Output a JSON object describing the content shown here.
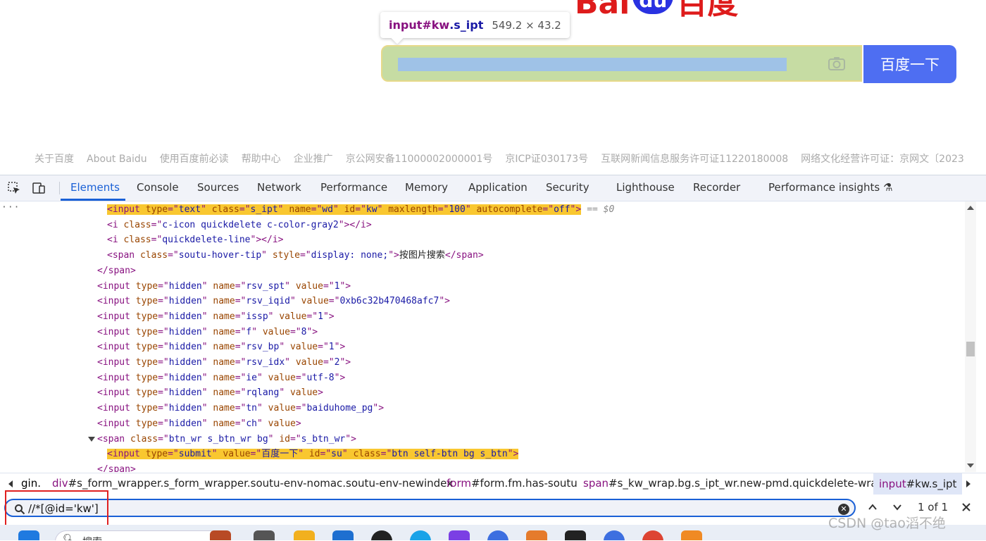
{
  "page": {
    "logo_text_left": "Bai",
    "logo_text_paw": "du",
    "logo_text_right": "百度",
    "tooltip": {
      "tag": "input",
      "id": "#kw",
      "class": ".s_ipt",
      "size": "549.2 × 43.2"
    },
    "search_button": "百度一下",
    "footer": [
      "关于百度",
      "About Baidu",
      "使用百度前必读",
      "帮助中心",
      "企业推广",
      "京公网安备11000002000001号",
      "京ICP证030173号",
      "互联网新闻信息服务许可证11220180008",
      "网络文化经营许可证：京网文〔2023"
    ]
  },
  "devtools": {
    "tabs": [
      "Elements",
      "Console",
      "Sources",
      "Network",
      "Performance",
      "Memory",
      "Application",
      "Security",
      "Lighthouse",
      "Recorder",
      "Performance insights"
    ],
    "active_tab": "Elements",
    "selected_suffix": "== $0",
    "lines": [
      [
        [
          "t",
          "<input "
        ],
        [
          "a",
          "type"
        ],
        [
          "t",
          "=\""
        ],
        [
          "v",
          "text"
        ],
        [
          "t",
          "\" "
        ],
        [
          "a",
          "class"
        ],
        [
          "t",
          "=\""
        ],
        [
          "v",
          "s_ipt"
        ],
        [
          "t",
          "\" "
        ],
        [
          "a",
          "name"
        ],
        [
          "t",
          "=\""
        ],
        [
          "v",
          "wd"
        ],
        [
          "t",
          "\" "
        ],
        [
          "a",
          "id"
        ],
        [
          "t",
          "=\""
        ],
        [
          "v",
          "kw"
        ],
        [
          "t",
          "\" "
        ],
        [
          "a",
          "maxlength"
        ],
        [
          "t",
          "=\""
        ],
        [
          "v",
          "100"
        ],
        [
          "t",
          "\" "
        ],
        [
          "a",
          "autocomplete"
        ],
        [
          "t",
          "=\""
        ],
        [
          "v",
          "off"
        ],
        [
          "t",
          "\">"
        ]
      ],
      [
        [
          "t",
          "<i "
        ],
        [
          "a",
          "class"
        ],
        [
          "t",
          "=\""
        ],
        [
          "v",
          "c-icon quickdelete c-color-gray2"
        ],
        [
          "t",
          "\">"
        ],
        [
          "x",
          ""
        ],
        [
          "t",
          "</i>"
        ]
      ],
      [
        [
          "t",
          "<i "
        ],
        [
          "a",
          "class"
        ],
        [
          "t",
          "=\""
        ],
        [
          "v",
          "quickdelete-line"
        ],
        [
          "t",
          "\"></i>"
        ]
      ],
      [
        [
          "t",
          "<span "
        ],
        [
          "a",
          "class"
        ],
        [
          "t",
          "=\""
        ],
        [
          "v",
          "soutu-hover-tip"
        ],
        [
          "t",
          "\" "
        ],
        [
          "a",
          "style"
        ],
        [
          "t",
          "=\""
        ],
        [
          "v",
          "display: none;"
        ],
        [
          "t",
          "\">"
        ],
        [
          "x",
          "按图片搜索"
        ],
        [
          "t",
          "</span>"
        ]
      ],
      [
        [
          "t",
          "</span>"
        ]
      ],
      [
        [
          "t",
          "<input "
        ],
        [
          "a",
          "type"
        ],
        [
          "t",
          "=\""
        ],
        [
          "v",
          "hidden"
        ],
        [
          "t",
          "\" "
        ],
        [
          "a",
          "name"
        ],
        [
          "t",
          "=\""
        ],
        [
          "v",
          "rsv_spt"
        ],
        [
          "t",
          "\" "
        ],
        [
          "a",
          "value"
        ],
        [
          "t",
          "=\""
        ],
        [
          "v",
          "1"
        ],
        [
          "t",
          "\">"
        ]
      ],
      [
        [
          "t",
          "<input "
        ],
        [
          "a",
          "type"
        ],
        [
          "t",
          "=\""
        ],
        [
          "v",
          "hidden"
        ],
        [
          "t",
          "\" "
        ],
        [
          "a",
          "name"
        ],
        [
          "t",
          "=\""
        ],
        [
          "v",
          "rsv_iqid"
        ],
        [
          "t",
          "\" "
        ],
        [
          "a",
          "value"
        ],
        [
          "t",
          "=\""
        ],
        [
          "v",
          "0xb6c32b470468afc7"
        ],
        [
          "t",
          "\">"
        ]
      ],
      [
        [
          "t",
          "<input "
        ],
        [
          "a",
          "type"
        ],
        [
          "t",
          "=\""
        ],
        [
          "v",
          "hidden"
        ],
        [
          "t",
          "\" "
        ],
        [
          "a",
          "name"
        ],
        [
          "t",
          "=\""
        ],
        [
          "v",
          "issp"
        ],
        [
          "t",
          "\" "
        ],
        [
          "a",
          "value"
        ],
        [
          "t",
          "=\""
        ],
        [
          "v",
          "1"
        ],
        [
          "t",
          "\">"
        ]
      ],
      [
        [
          "t",
          "<input "
        ],
        [
          "a",
          "type"
        ],
        [
          "t",
          "=\""
        ],
        [
          "v",
          "hidden"
        ],
        [
          "t",
          "\" "
        ],
        [
          "a",
          "name"
        ],
        [
          "t",
          "=\""
        ],
        [
          "v",
          "f"
        ],
        [
          "t",
          "\" "
        ],
        [
          "a",
          "value"
        ],
        [
          "t",
          "=\""
        ],
        [
          "v",
          "8"
        ],
        [
          "t",
          "\">"
        ]
      ],
      [
        [
          "t",
          "<input "
        ],
        [
          "a",
          "type"
        ],
        [
          "t",
          "=\""
        ],
        [
          "v",
          "hidden"
        ],
        [
          "t",
          "\" "
        ],
        [
          "a",
          "name"
        ],
        [
          "t",
          "=\""
        ],
        [
          "v",
          "rsv_bp"
        ],
        [
          "t",
          "\" "
        ],
        [
          "a",
          "value"
        ],
        [
          "t",
          "=\""
        ],
        [
          "v",
          "1"
        ],
        [
          "t",
          "\">"
        ]
      ],
      [
        [
          "t",
          "<input "
        ],
        [
          "a",
          "type"
        ],
        [
          "t",
          "=\""
        ],
        [
          "v",
          "hidden"
        ],
        [
          "t",
          "\" "
        ],
        [
          "a",
          "name"
        ],
        [
          "t",
          "=\""
        ],
        [
          "v",
          "rsv_idx"
        ],
        [
          "t",
          "\" "
        ],
        [
          "a",
          "value"
        ],
        [
          "t",
          "=\""
        ],
        [
          "v",
          "2"
        ],
        [
          "t",
          "\">"
        ]
      ],
      [
        [
          "t",
          "<input "
        ],
        [
          "a",
          "type"
        ],
        [
          "t",
          "=\""
        ],
        [
          "v",
          "hidden"
        ],
        [
          "t",
          "\" "
        ],
        [
          "a",
          "name"
        ],
        [
          "t",
          "=\""
        ],
        [
          "v",
          "ie"
        ],
        [
          "t",
          "\" "
        ],
        [
          "a",
          "value"
        ],
        [
          "t",
          "=\""
        ],
        [
          "v",
          "utf-8"
        ],
        [
          "t",
          "\">"
        ]
      ],
      [
        [
          "t",
          "<input "
        ],
        [
          "a",
          "type"
        ],
        [
          "t",
          "=\""
        ],
        [
          "v",
          "hidden"
        ],
        [
          "t",
          "\" "
        ],
        [
          "a",
          "name"
        ],
        [
          "t",
          "=\""
        ],
        [
          "v",
          "rqlang"
        ],
        [
          "t",
          "\" "
        ],
        [
          "a",
          "value"
        ],
        [
          "t",
          ">"
        ]
      ],
      [
        [
          "t",
          "<input "
        ],
        [
          "a",
          "type"
        ],
        [
          "t",
          "=\""
        ],
        [
          "v",
          "hidden"
        ],
        [
          "t",
          "\" "
        ],
        [
          "a",
          "name"
        ],
        [
          "t",
          "=\""
        ],
        [
          "v",
          "tn"
        ],
        [
          "t",
          "\" "
        ],
        [
          "a",
          "value"
        ],
        [
          "t",
          "=\""
        ],
        [
          "v",
          "baiduhome_pg"
        ],
        [
          "t",
          "\">"
        ]
      ],
      [
        [
          "t",
          "<input "
        ],
        [
          "a",
          "type"
        ],
        [
          "t",
          "=\""
        ],
        [
          "v",
          "hidden"
        ],
        [
          "t",
          "\" "
        ],
        [
          "a",
          "name"
        ],
        [
          "t",
          "=\""
        ],
        [
          "v",
          "ch"
        ],
        [
          "t",
          "\" "
        ],
        [
          "a",
          "value"
        ],
        [
          "t",
          ">"
        ]
      ],
      [
        [
          "t",
          "<span "
        ],
        [
          "a",
          "class"
        ],
        [
          "t",
          "=\""
        ],
        [
          "v",
          "btn_wr s_btn_wr bg"
        ],
        [
          "t",
          "\" "
        ],
        [
          "a",
          "id"
        ],
        [
          "t",
          "=\""
        ],
        [
          "v",
          "s_btn_wr"
        ],
        [
          "t",
          "\">"
        ]
      ],
      [
        [
          "t",
          "<input "
        ],
        [
          "a",
          "type"
        ],
        [
          "t",
          "=\""
        ],
        [
          "v",
          "submit"
        ],
        [
          "t",
          "\" "
        ],
        [
          "a",
          "value"
        ],
        [
          "t",
          "=\""
        ],
        [
          "v",
          "百度一下"
        ],
        [
          "t",
          "\" "
        ],
        [
          "a",
          "id"
        ],
        [
          "t",
          "=\""
        ],
        [
          "v",
          "su"
        ],
        [
          "t",
          "\" "
        ],
        [
          "a",
          "class"
        ],
        [
          "t",
          "=\""
        ],
        [
          "v",
          "btn self-btn bg s_btn"
        ],
        [
          "t",
          "\">"
        ]
      ],
      [
        [
          "t",
          "</span>"
        ]
      ]
    ],
    "breadcrumbs": [
      "gin.",
      "div#s_form_wrapper.s_form_wrapper.soutu-env-nomac.soutu-env-newindex",
      "form#form.fm.has-soutu",
      "span#s_kw_wrap.bg.s_ipt_wr.new-pmd.quickdelete-wrap",
      "input#kw.s_ipt"
    ],
    "search": {
      "value": "//*[@id='kw']",
      "match_count": "1 of 1"
    }
  },
  "taskbar": {
    "search_label": "搜索"
  },
  "watermark": "CSDN @tao滔不绝",
  "colors": {
    "accent": "#1a60d6",
    "baidu_blue": "#4e6ef2",
    "highlight": "#f9c730",
    "red_box": "#e02020"
  }
}
